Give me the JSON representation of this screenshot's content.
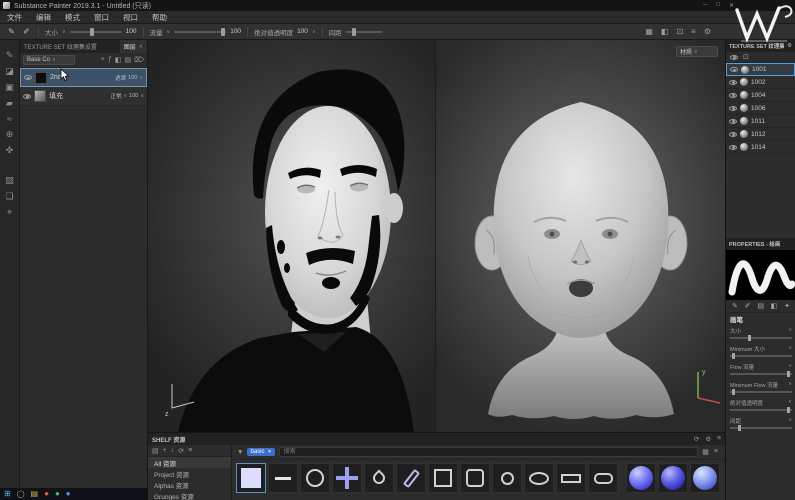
{
  "window": {
    "title": "Substance Painter 2019.3.1 - Untitled (只读)"
  },
  "menu": {
    "items": [
      "文件",
      "编辑",
      "模式",
      "窗口",
      "视口",
      "帮助"
    ]
  },
  "toolbar": {
    "size_label": "大小",
    "size_value": "100",
    "flow_label": "流量",
    "flow_value": "100",
    "opacity_label": "绝对值透明度",
    "opacity_value": "100",
    "spacing_label": "间距"
  },
  "viewport": {
    "shading_mode": "材质"
  },
  "left_panel": {
    "tab_texture_set": "TEXTURE SET 纹理集设置",
    "tab_layers": "图层",
    "channel_dropdown": "Base Co",
    "layers": [
      {
        "name": "2nd",
        "mask": "遮罩",
        "opacity": "100"
      },
      {
        "name": "填充",
        "blend": "正常",
        "opacity": "100"
      }
    ]
  },
  "texture_sets": {
    "header": "TEXTURE SET 纹理集列表",
    "items": [
      "1001",
      "1002",
      "1004",
      "1006",
      "1011",
      "1012",
      "1014"
    ]
  },
  "properties": {
    "header": "PROPERTIES - 绘画",
    "section": "画笔",
    "sliders": [
      {
        "label": "大小"
      },
      {
        "label": "Minimum 大小"
      },
      {
        "label": "Flow 流量"
      },
      {
        "label": "Minimum Flow 流量"
      },
      {
        "label": "绝对值透明度"
      },
      {
        "label": "间距"
      }
    ]
  },
  "shelf": {
    "header": "SHELF 资源",
    "folders": [
      "All 资源",
      "Project 资源",
      "Alphas 资源",
      "Grunges 资源"
    ],
    "filter_tag": "basic",
    "search_placeholder": "搜索"
  },
  "colors": {
    "accent_blue": "#5a9fd4",
    "selection": "#3d5268",
    "tag_blue": "#3a6fd0",
    "sphere_blue": "#7478f2"
  },
  "icons": {
    "minimize": "─",
    "maximize": "□",
    "close": "✕",
    "chev": "∨",
    "pen": "✎",
    "pen2": "✐",
    "eraser": "◪",
    "projection": "▣",
    "fill": "▰",
    "smudge": "≈",
    "clone": "⊕",
    "picker": "✜",
    "mask": "▨",
    "stencil": "❏",
    "target": "⌖",
    "grid": "▦",
    "half": "◧",
    "box": "⊡",
    "lines": "≡",
    "gear": "⚙",
    "plus": "+",
    "fx": "ƒ",
    "list": "▤",
    "trash": "⌦",
    "refresh": "⟳",
    "down": "↓",
    "funnel": "▼",
    "star": "✦",
    "tag_close": "✕",
    "win": "⊞",
    "circle": "◯",
    "folder": "▤",
    "dot": "●"
  }
}
